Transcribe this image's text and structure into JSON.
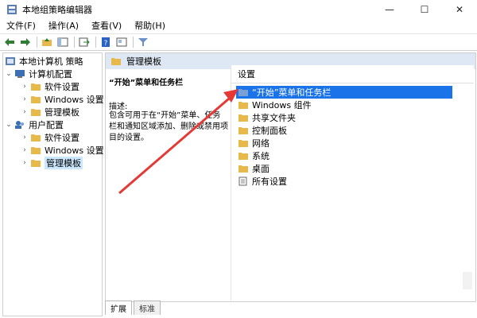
{
  "window": {
    "title": "本地组策略编辑器",
    "minimize_glyph": "—",
    "maximize_glyph": "☐",
    "close_glyph": "✕"
  },
  "menu": [
    {
      "label": "文件(F)"
    },
    {
      "label": "操作(A)"
    },
    {
      "label": "查看(V)"
    },
    {
      "label": "帮助(H)"
    }
  ],
  "tree": {
    "root": "本地计算机 策略",
    "computer_config": "计算机配置",
    "computer_children": [
      "软件设置",
      "Windows 设置",
      "管理模板"
    ],
    "user_config": "用户配置",
    "user_children": [
      "软件设置",
      "Windows 设置",
      "管理模板"
    ]
  },
  "right_header": "管理模板",
  "description": {
    "title": "“开始”菜单和任务栏",
    "label": "描述:",
    "text": "包含可用于在“开始”菜单、任务栏和通知区域添加、删除或禁用项目的设置。"
  },
  "settings": {
    "header": "设置",
    "items": [
      {
        "label": "“开始”菜单和任务栏",
        "icon": "settings-folder-icon",
        "selected": true
      },
      {
        "label": "Windows 组件",
        "icon": "folder-icon"
      },
      {
        "label": "共享文件夹",
        "icon": "folder-icon"
      },
      {
        "label": "控制面板",
        "icon": "folder-icon"
      },
      {
        "label": "网络",
        "icon": "folder-icon"
      },
      {
        "label": "系统",
        "icon": "folder-icon"
      },
      {
        "label": "桌面",
        "icon": "folder-icon"
      },
      {
        "label": "所有设置",
        "icon": "all-settings-icon"
      }
    ]
  },
  "tabs": [
    {
      "label": "扩展"
    },
    {
      "label": "标准"
    }
  ],
  "colors": {
    "selection": "#1a73e8",
    "header_bg": "#dde8f4",
    "folder": "#e8b84a",
    "annotation_arrow": "#e53935"
  }
}
